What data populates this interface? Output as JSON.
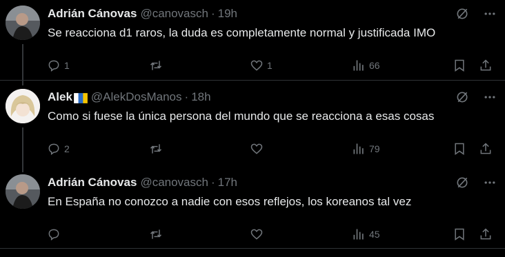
{
  "tweets": [
    {
      "name": "Adrián Cánovas",
      "handle": "@canovasch",
      "time": "19h",
      "text": "Se reacciona d1 raros, la duda es completamente normal y justificada IMO",
      "replies": "1",
      "retweets": "",
      "likes": "1",
      "views": "66"
    },
    {
      "name": "Alek",
      "handle": "@AlekDosManos",
      "time": "18h",
      "text": "Como si fuese la única persona del mundo que se reacciona a esas cosas",
      "replies": "2",
      "retweets": "",
      "likes": "",
      "views": "79"
    },
    {
      "name": "Adrián Cánovas",
      "handle": "@canovasch",
      "time": "17h",
      "text": "En España no conozco a nadie con esos reflejos, los koreanos tal vez",
      "replies": "",
      "retweets": "",
      "likes": "",
      "views": "45"
    }
  ],
  "colors": {
    "text": "#e7e9ea",
    "muted": "#71767b",
    "background": "#000000"
  },
  "icons": [
    "reply-icon",
    "retweet-icon",
    "like-icon",
    "views-icon",
    "bookmark-icon",
    "share-icon",
    "grok-icon",
    "more-icon"
  ]
}
